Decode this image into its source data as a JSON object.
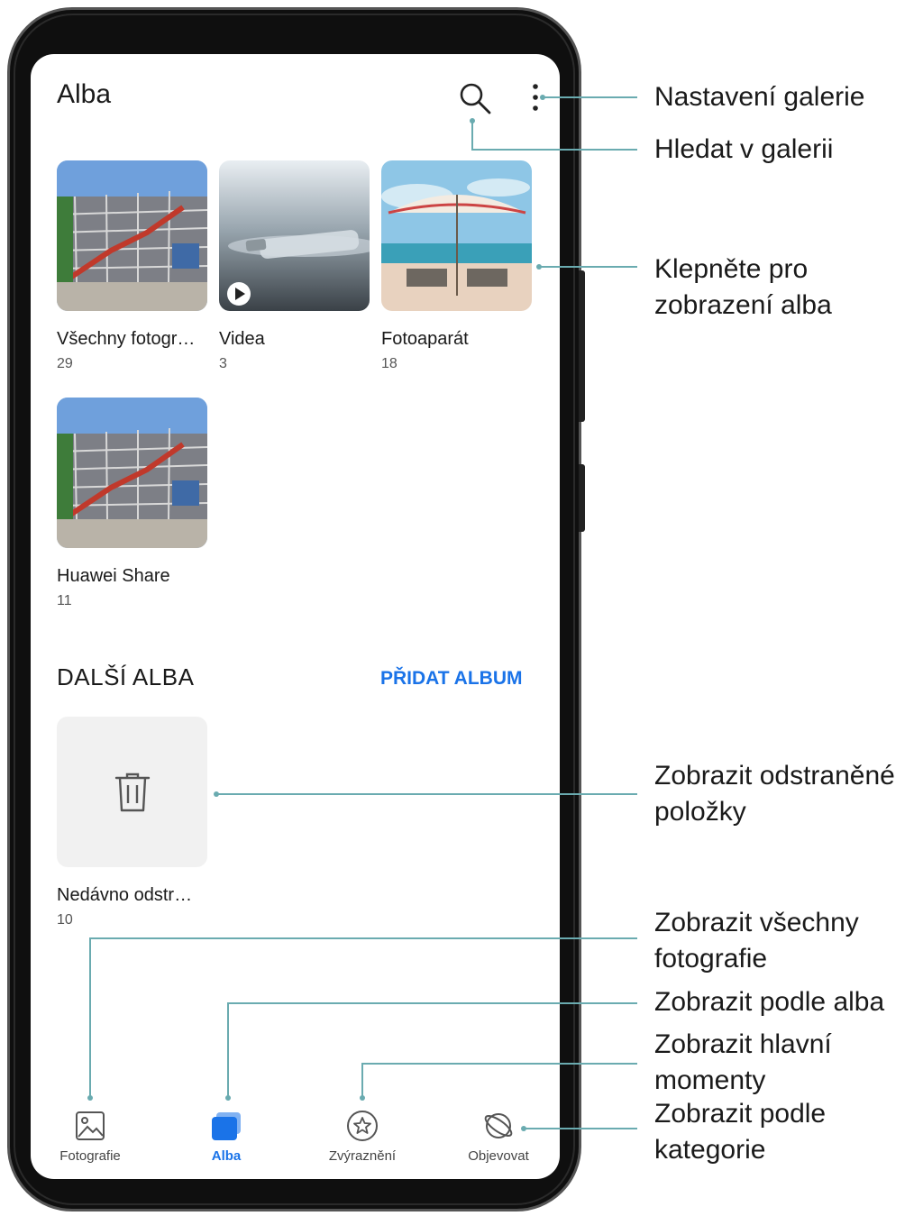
{
  "screen": {
    "title": "Alba",
    "albums": [
      {
        "name": "Všechny fotogr…",
        "count": "29"
      },
      {
        "name": "Videa",
        "count": "3"
      },
      {
        "name": "Fotoaparát",
        "count": "18"
      },
      {
        "name": "Huawei Share",
        "count": "11"
      }
    ],
    "more_albums": {
      "title": "DALŠÍ ALBA",
      "add_label": "PŘIDAT ALBUM",
      "recently_deleted": {
        "name": "Nedávno odstr…",
        "count": "10"
      }
    },
    "tabs": [
      {
        "label": "Fotografie",
        "icon": "image-icon"
      },
      {
        "label": "Alba",
        "icon": "albums-icon",
        "active": true
      },
      {
        "label": "Zvýraznění",
        "icon": "star-circle-icon"
      },
      {
        "label": "Objevovat",
        "icon": "planet-icon"
      }
    ]
  },
  "callouts": {
    "settings": "Nastavení galerie",
    "search": "Hledat v galerii",
    "open_album": [
      "Klepněte pro",
      "zobrazení alba"
    ],
    "deleted": [
      "Zobrazit odstraněné",
      "položky"
    ],
    "all_photos": [
      "Zobrazit všechny",
      "fotografie"
    ],
    "by_album": "Zobrazit podle alba",
    "highlights": [
      "Zobrazit hlavní",
      "momenty"
    ],
    "by_category": [
      "Zobrazit podle",
      "kategorie"
    ]
  },
  "colors": {
    "accent": "#1a73e8",
    "leader_line": "#6aabb0"
  }
}
